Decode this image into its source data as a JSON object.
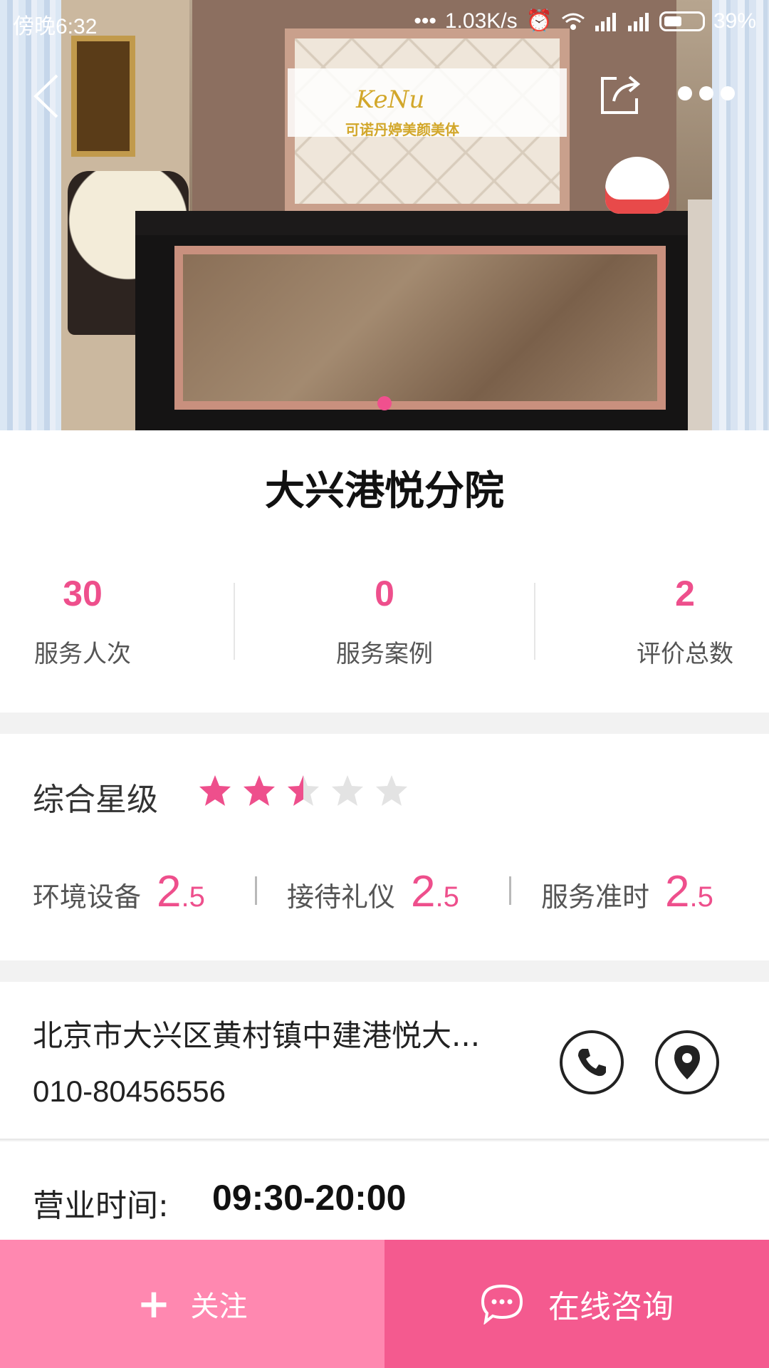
{
  "status_bar": {
    "time": "傍晚6:32",
    "network_speed": "1.03K/s",
    "battery": "39%"
  },
  "hero": {
    "brand_logo_text": "KeNu",
    "brand_subtitle": "可诺丹婷美颜美体",
    "slide_count": 1,
    "active_slide": 1
  },
  "clinic": {
    "name": "大兴港悦分院"
  },
  "stats": [
    {
      "value": "30",
      "label": "服务人次"
    },
    {
      "value": "0",
      "label": "服务案例"
    },
    {
      "value": "2",
      "label": "评价总数"
    }
  ],
  "rating": {
    "overall_label": "综合星级",
    "overall_stars": 2.5,
    "max_stars": 5,
    "items": [
      {
        "label": "环境设备",
        "int": "2",
        "dec": ".5"
      },
      {
        "label": "接待礼仪",
        "int": "2",
        "dec": ".5"
      },
      {
        "label": "服务准时",
        "int": "2",
        "dec": ".5"
      }
    ]
  },
  "contact": {
    "address": "北京市大兴区黄村镇中建港悦大...",
    "phone": "010-80456556"
  },
  "hours": {
    "label": "营业时间:",
    "value": "09:30-20:00"
  },
  "actions": {
    "follow_label": "关注",
    "consult_label": "在线咨询"
  },
  "colors": {
    "accent": "#ee4f8c",
    "follow_bg": "#ff88b0",
    "consult_bg": "#f45a8f",
    "star_off": "#e3e3e3"
  }
}
